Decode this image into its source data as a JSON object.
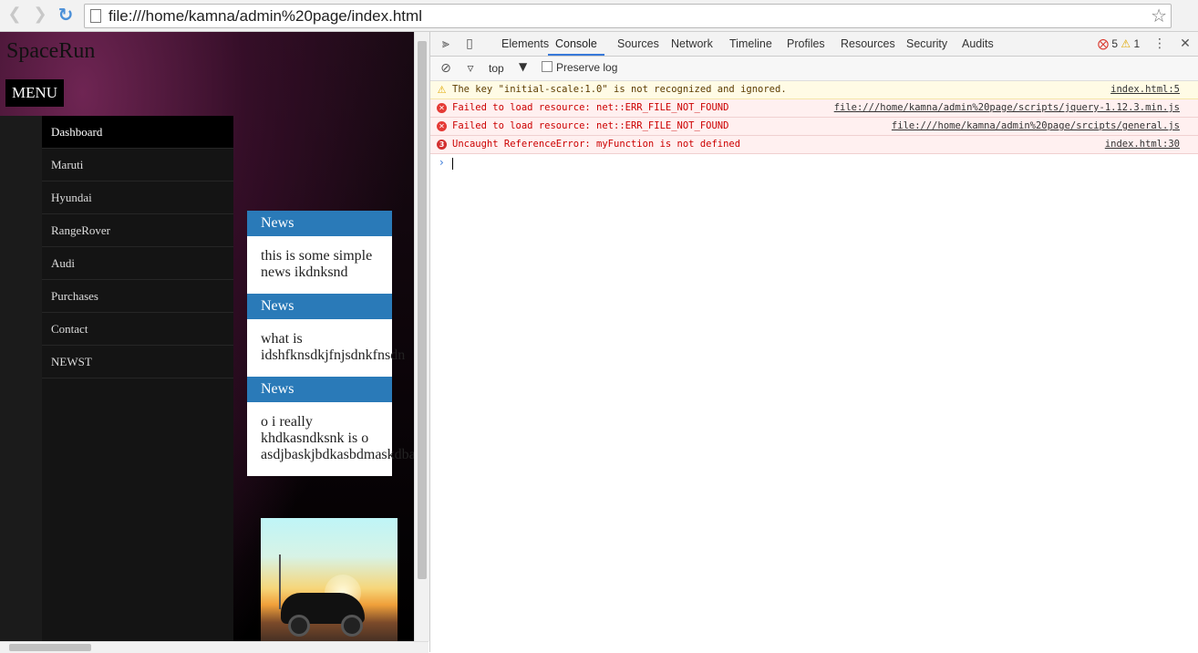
{
  "browser": {
    "url": "file:///home/kamna/admin%20page/index.html"
  },
  "page": {
    "site_title": "SpaceRun",
    "menu_label": "MENU",
    "sidebar": [
      {
        "label": "Dashboard",
        "active": true
      },
      {
        "label": "Maruti"
      },
      {
        "label": "Hyundai"
      },
      {
        "label": "RangeRover"
      },
      {
        "label": "Audi"
      },
      {
        "label": "Purchases"
      },
      {
        "label": "Contact"
      },
      {
        "label": "NEWST"
      }
    ],
    "news": [
      {
        "heading": "News",
        "body": "this is some simple news ikdnksnd"
      },
      {
        "heading": "News",
        "body": "what is idshfknsdkjfnjsdnkfnsdn"
      },
      {
        "heading": "News",
        "body": "o i really khdkasndksnk is o asdjbaskjbdkasbdmaskdba"
      }
    ]
  },
  "devtools": {
    "tabs": [
      "Elements",
      "Console",
      "Sources",
      "Network",
      "Timeline",
      "Profiles",
      "Resources",
      "Security",
      "Audits"
    ],
    "active_tab": "Console",
    "error_count": "5",
    "warning_count": "1",
    "context": "top",
    "preserve_log": "Preserve log",
    "messages": [
      {
        "level": "warning",
        "text": "The key \"initial-scale:1.0\" is not recognized and ignored.",
        "source": "index.html:5"
      },
      {
        "level": "error",
        "text": "Failed to load resource: net::ERR_FILE_NOT_FOUND",
        "source": "file:///home/kamna/admin%20page/scripts/jquery-1.12.3.min.js"
      },
      {
        "level": "error",
        "text": "Failed to load resource: net::ERR_FILE_NOT_FOUND",
        "source": "file:///home/kamna/admin%20page/srcipts/general.js"
      },
      {
        "level": "error",
        "count": "3",
        "text": "Uncaught ReferenceError: myFunction is not defined",
        "source": "index.html:30"
      }
    ]
  },
  "colors": {
    "news_header": "#2a7ab8",
    "devtools_accent": "#3879d9",
    "error": "#cc0000"
  }
}
